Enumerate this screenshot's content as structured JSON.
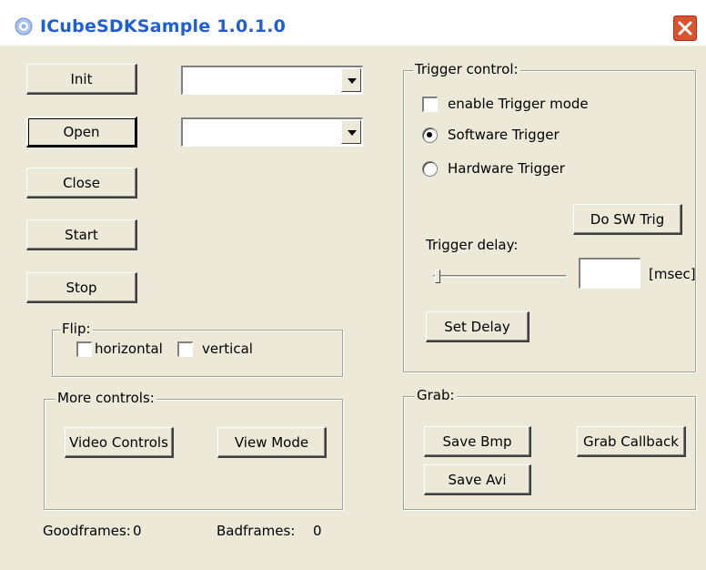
{
  "window": {
    "title": "ICubeSDKSample 1.0.1.0",
    "title_color": "#1c5fd6",
    "close_icon": "close-icon"
  },
  "left": {
    "init_label": "Init",
    "open_label": "Open",
    "close_label": "Close",
    "start_label": "Start",
    "stop_label": "Stop",
    "combo1_value": "",
    "combo2_value": ""
  },
  "flip": {
    "label": "Flip:",
    "horizontal_label": "horizontal",
    "horizontal_checked": false,
    "vertical_label": "vertical",
    "vertical_checked": false
  },
  "more_controls": {
    "label": "More controls:",
    "video_controls_label": "Video Controls",
    "view_mode_label": "View Mode"
  },
  "status": {
    "goodframes_label": "Goodframes:",
    "goodframes_value": "0",
    "badframes_label": "Badframes:",
    "badframes_value": "0"
  },
  "trigger": {
    "label": "Trigger control:",
    "enable_label": "enable Trigger mode",
    "enable_checked": false,
    "software_label": "Software Trigger",
    "software_selected": true,
    "hardware_label": "Hardware Trigger",
    "hardware_selected": false,
    "do_sw_trig_label": "Do SW Trig",
    "delay_label": "Trigger delay:",
    "delay_value": "",
    "delay_unit": "[msec]",
    "set_delay_label": "Set Delay",
    "slider_value": 0
  },
  "grab": {
    "label": "Grab:",
    "save_bmp_label": "Save Bmp",
    "grab_callback_label": "Grab Callback",
    "save_avi_label": "Save Avi"
  }
}
